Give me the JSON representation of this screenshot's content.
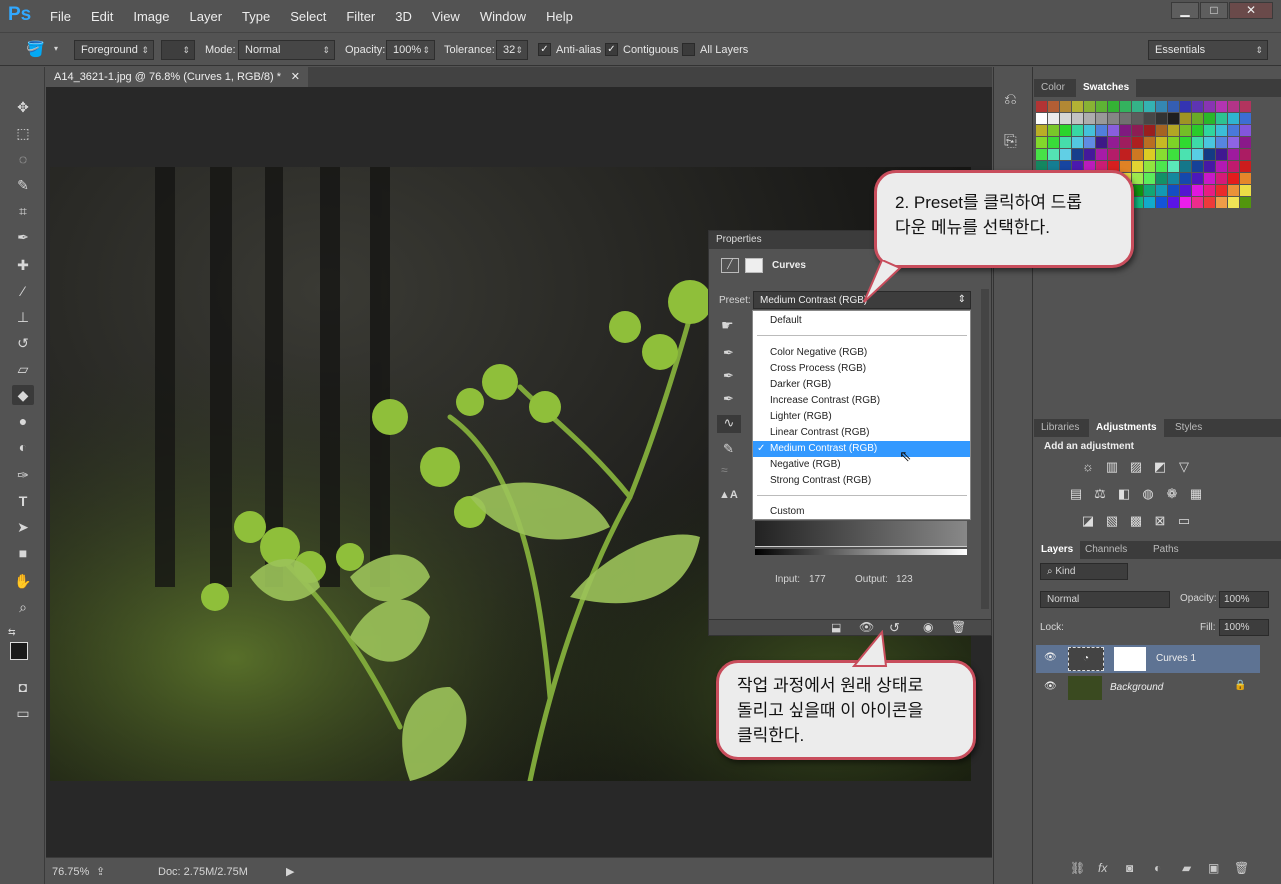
{
  "app": {
    "logo": "Ps",
    "menu": [
      "File",
      "Edit",
      "Image",
      "Layer",
      "Type",
      "Select",
      "Filter",
      "3D",
      "View",
      "Window",
      "Help"
    ]
  },
  "options": {
    "fill_source": "Foreground",
    "mode_label": "Mode:",
    "mode_value": "Normal",
    "opacity_label": "Opacity:",
    "opacity_value": "100%",
    "tolerance_label": "Tolerance:",
    "tolerance_value": "32",
    "anti_alias": "Anti-alias",
    "contiguous": "Contiguous",
    "all_layers": "All Layers",
    "workspace": "Essentials"
  },
  "document": {
    "tab_title": "A14_3621-1.jpg @ 76.8% (Curves 1, RGB/8) *",
    "zoom": "76.75%",
    "doc_size": "Doc: 2.75M/2.75M"
  },
  "properties": {
    "title": "Properties",
    "panel_name": "Curves",
    "preset_label": "Preset:",
    "preset_value": "Medium Contrast (RGB)",
    "input_label": "Input:",
    "input_value": "177",
    "output_label": "Output:",
    "output_value": "123",
    "preset_options": [
      "Default",
      "Color Negative (RGB)",
      "Cross Process (RGB)",
      "Darker (RGB)",
      "Increase Contrast (RGB)",
      "Lighter (RGB)",
      "Linear Contrast (RGB)",
      "Medium Contrast (RGB)",
      "Negative (RGB)",
      "Strong Contrast (RGB)",
      "Custom"
    ],
    "selected_preset": "Medium Contrast (RGB)"
  },
  "swatches_panel": {
    "tabs": [
      "Color",
      "Swatches"
    ]
  },
  "adjustments_panel": {
    "tabs": [
      "Libraries",
      "Adjustments",
      "Styles"
    ],
    "heading": "Add an adjustment"
  },
  "layers_panel": {
    "tabs": [
      "Layers",
      "Channels",
      "Paths"
    ],
    "filter": "Kind",
    "blend": "Normal",
    "opacity_label": "Opacity:",
    "opacity_value": "100%",
    "lock_label": "Lock:",
    "fill_label": "Fill:",
    "fill_value": "100%",
    "layers": [
      {
        "name": "Curves 1"
      },
      {
        "name": "Background"
      }
    ]
  },
  "callouts": {
    "preset_note": "2. Preset를 클릭하여 드롭\n다운 메뉴를 선택한다.",
    "reset_note": "작업 과정에서 원래 상태로\n돌리고 싶을때 이 아이콘을\n클릭한다."
  }
}
